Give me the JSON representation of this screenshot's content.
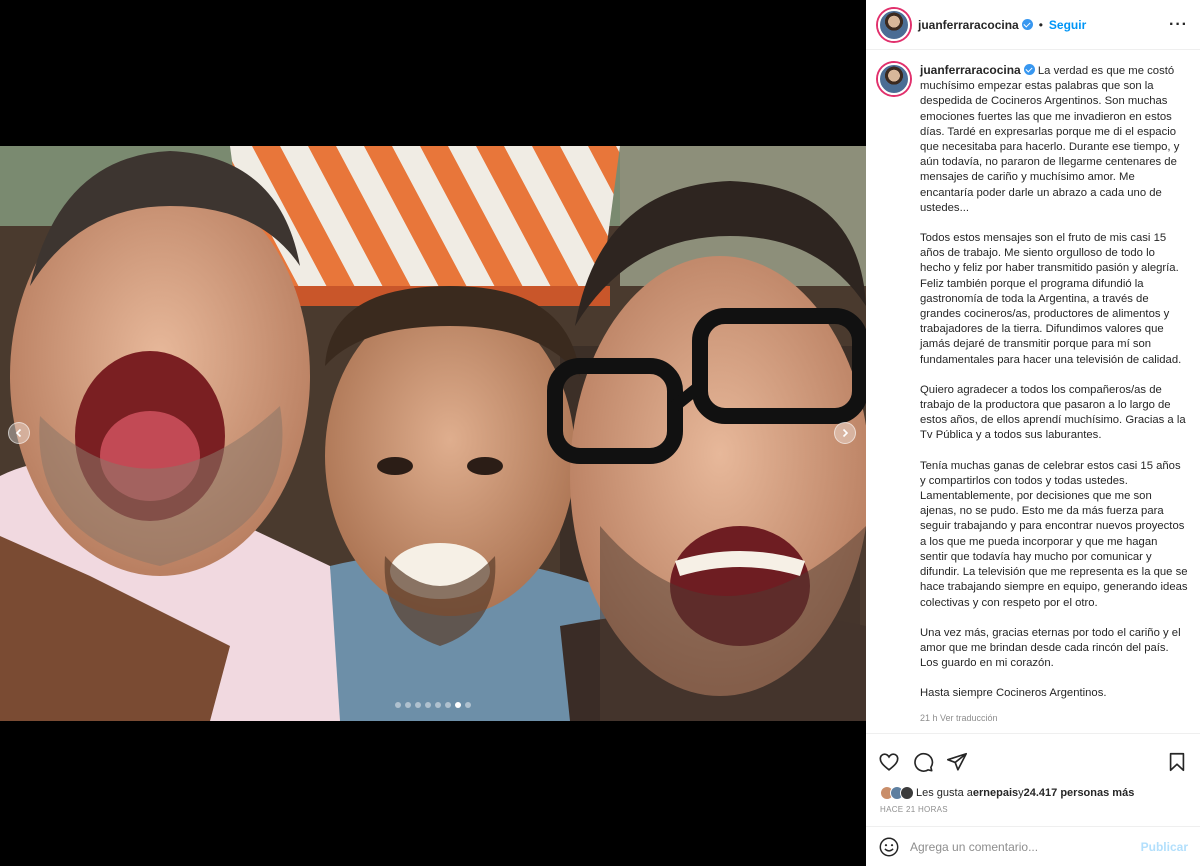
{
  "post": {
    "username": "juanferraracocina",
    "separator": "•",
    "follow_label": "Seguir",
    "more_label": "···"
  },
  "caption": {
    "username": "juanferraracocina",
    "paragraphs": [
      "La verdad es que me costó muchísimo empezar estas palabras que son la despedida de Cocineros Argentinos. Son muchas emociones fuertes las que me invadieron en estos días. Tardé en expresarlas porque me di el espacio que necesitaba para hacerlo. Durante ese tiempo, y aún todavía, no pararon de llegarme centenares de mensajes de cariño y muchísimo amor. Me encantaría poder darle un abrazo a cada uno de ustedes...",
      "Todos estos mensajes son el fruto de mis casi 15 años de trabajo. Me siento orgulloso de todo lo hecho y feliz por haber transmitido pasión y alegría. Feliz también porque el programa difundió la gastronomía de toda la Argentina, a través de grandes cocineros/as, productores de alimentos y trabajadores de la tierra. Difundimos valores que jamás dejaré de transmitir porque para mí son fundamentales para hacer una televisión de calidad.",
      "Quiero agradecer a todos los compañeros/as de trabajo de la productora que pasaron a lo largo de estos años, de ellos aprendí muchísimo. Gracias a la Tv Pública y a todos sus laburantes.",
      "Tenía muchas ganas de celebrar estos casi 15 años y compartirlos con todos y todas ustedes. Lamentablemente, por decisiones que me son ajenas, no se pudo. Esto me da más fuerza para seguir trabajando y para encontrar nuevos proyectos a los que me pueda incorporar y que me hagan sentir que todavía hay mucho por comunicar y difundir. La televisión que me representa es la que se hace trabajando siempre en equipo, generando ideas colectivas y con respeto por el otro.",
      "Una vez más, gracias eternas por todo el cariño y el amor que me brindan desde cada rincón del país. Los guardo en mi corazón.",
      "Hasta siempre Cocineros Argentinos."
    ],
    "meta": "21 h   Ver traducción"
  },
  "likes": {
    "prefix": "Les gusta a ",
    "user": "ernepais",
    "middle": " y ",
    "count": "24.417 personas más"
  },
  "time_ago": "HACE 21 HORAS",
  "comment": {
    "placeholder": "Agrega un comentario...",
    "publish_label": "Publicar"
  },
  "carousel": {
    "total": 8,
    "active_index": 6
  },
  "colors": {
    "link": "#0095f6",
    "verified": "#3897f0",
    "publish_disabled": "#b2dffc"
  }
}
